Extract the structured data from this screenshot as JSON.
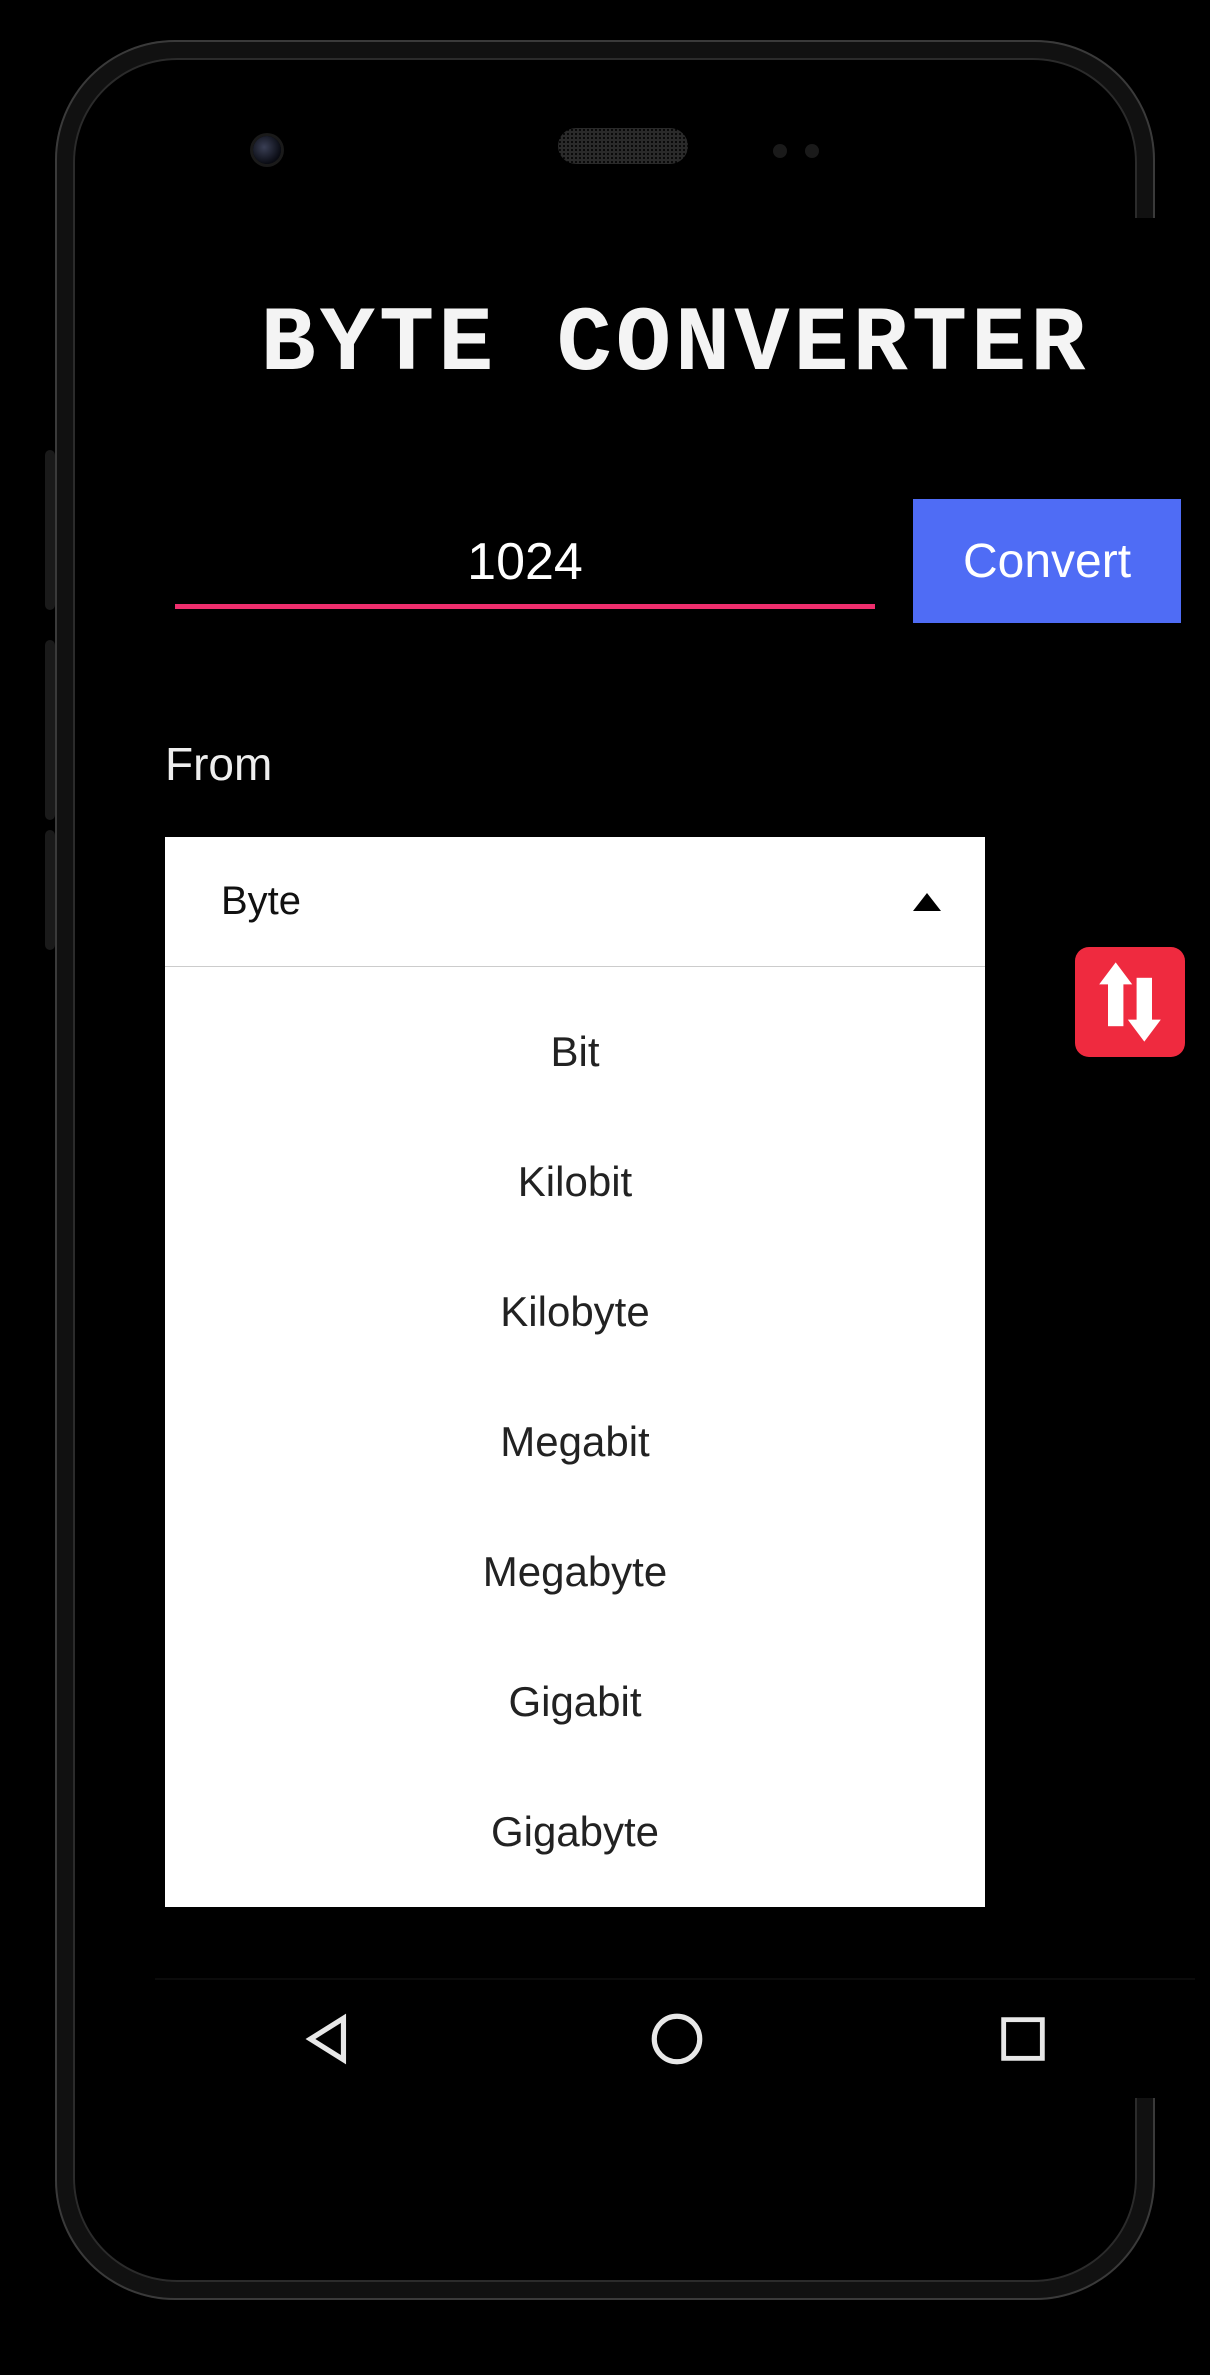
{
  "app": {
    "title": "BYTE CONVERTER",
    "value_input": "1024",
    "convert_label": "Convert",
    "from_label": "From",
    "selected_unit": "Byte",
    "dropdown_items": [
      "Bit",
      "Kilobit",
      "Kilobyte",
      "Megabit",
      "Megabyte",
      "Gigabit",
      "Gigabyte"
    ]
  },
  "icons": {
    "swap": "swap-vertical-icon",
    "dropdown_arrow": "arrow-up-icon",
    "nav_back": "triangle-back-icon",
    "nav_home": "circle-home-icon",
    "nav_recent": "square-recent-icon"
  },
  "colors": {
    "accent_pink": "#ef2e6d",
    "button_blue": "#4f6cf5",
    "swap_red": "#ef2a3f",
    "background": "#000000",
    "text": "#ffffff"
  }
}
